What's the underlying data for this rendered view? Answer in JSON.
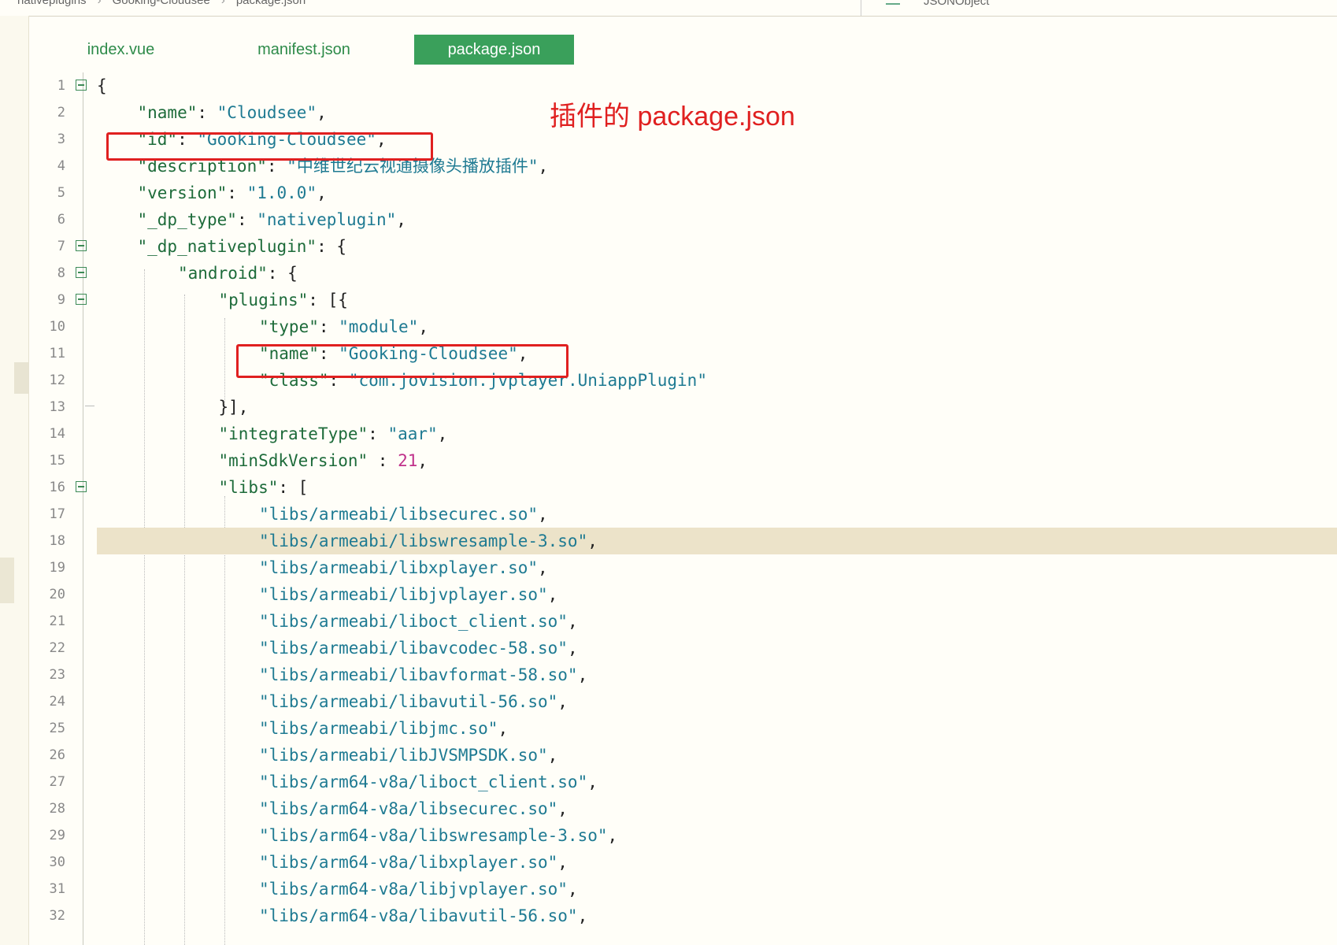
{
  "breadcrumb": [
    "nativeplugins",
    "Gooking-Cloudsee",
    "package.json"
  ],
  "outline_label": "JSONObject",
  "tabs": [
    {
      "label": "index.vue",
      "active": false
    },
    {
      "label": "manifest.json",
      "active": false
    },
    {
      "label": "package.json",
      "active": true
    }
  ],
  "annotation": "插件的 package.json",
  "colors": {
    "accent": "#3aa05b",
    "annotation": "#e02020",
    "highlight_line": "#ece3c9"
  },
  "highlighted_line": 18,
  "lines": [
    {
      "n": "1",
      "indent": 0,
      "fold": true,
      "parts": [
        [
          "p",
          "{"
        ]
      ]
    },
    {
      "n": "2",
      "indent": 1,
      "parts": [
        [
          "k",
          "\"name\""
        ],
        [
          "p",
          ": "
        ],
        [
          "s",
          "\"Cloudsee\""
        ],
        [
          "p",
          ","
        ]
      ]
    },
    {
      "n": "3",
      "indent": 1,
      "parts": [
        [
          "k",
          "\"id\""
        ],
        [
          "p",
          ": "
        ],
        [
          "s",
          "\"Gooking-Cloudsee\""
        ],
        [
          "p",
          ","
        ]
      ]
    },
    {
      "n": "4",
      "indent": 1,
      "parts": [
        [
          "k",
          "\"description\""
        ],
        [
          "p",
          ": "
        ],
        [
          "s",
          "\"中维世纪云视通摄像头播放插件\""
        ],
        [
          "p",
          ","
        ]
      ]
    },
    {
      "n": "5",
      "indent": 1,
      "parts": [
        [
          "k",
          "\"version\""
        ],
        [
          "p",
          ": "
        ],
        [
          "s",
          "\"1.0.0\""
        ],
        [
          "p",
          ","
        ]
      ]
    },
    {
      "n": "6",
      "indent": 1,
      "parts": [
        [
          "k",
          "\"_dp_type\""
        ],
        [
          "p",
          ": "
        ],
        [
          "s",
          "\"nativeplugin\""
        ],
        [
          "p",
          ","
        ]
      ]
    },
    {
      "n": "7",
      "indent": 1,
      "fold": true,
      "parts": [
        [
          "k",
          "\"_dp_nativeplugin\""
        ],
        [
          "p",
          ": {"
        ]
      ]
    },
    {
      "n": "8",
      "indent": 2,
      "fold": true,
      "parts": [
        [
          "k",
          "\"android\""
        ],
        [
          "p",
          ": {"
        ]
      ]
    },
    {
      "n": "9",
      "indent": 3,
      "fold": true,
      "parts": [
        [
          "k",
          "\"plugins\""
        ],
        [
          "p",
          ": [{"
        ]
      ]
    },
    {
      "n": "10",
      "indent": 4,
      "parts": [
        [
          "k",
          "\"type\""
        ],
        [
          "p",
          ": "
        ],
        [
          "s",
          "\"module\""
        ],
        [
          "p",
          ","
        ]
      ]
    },
    {
      "n": "11",
      "indent": 4,
      "parts": [
        [
          "k",
          "\"name\""
        ],
        [
          "p",
          ": "
        ],
        [
          "s",
          "\"Gooking-Cloudsee\""
        ],
        [
          "p",
          ","
        ]
      ]
    },
    {
      "n": "12",
      "indent": 4,
      "parts": [
        [
          "k",
          "\"class\""
        ],
        [
          "p",
          ": "
        ],
        [
          "s",
          "\"com.jovision.jvplayer.UniappPlugin\""
        ]
      ]
    },
    {
      "n": "13",
      "indent": 3,
      "foldend": true,
      "parts": [
        [
          "p",
          "}],"
        ]
      ]
    },
    {
      "n": "14",
      "indent": 3,
      "parts": [
        [
          "k",
          "\"integrateType\""
        ],
        [
          "p",
          ": "
        ],
        [
          "s",
          "\"aar\""
        ],
        [
          "p",
          ","
        ]
      ]
    },
    {
      "n": "15",
      "indent": 3,
      "parts": [
        [
          "k",
          "\"minSdkVersion\""
        ],
        [
          "p",
          " : "
        ],
        [
          "n",
          "21"
        ],
        [
          "p",
          ","
        ]
      ]
    },
    {
      "n": "16",
      "indent": 3,
      "fold": true,
      "parts": [
        [
          "k",
          "\"libs\""
        ],
        [
          "p",
          ": ["
        ]
      ]
    },
    {
      "n": "17",
      "indent": 4,
      "parts": [
        [
          "s",
          "\"libs/armeabi/libsecurec.so\""
        ],
        [
          "p",
          ","
        ]
      ]
    },
    {
      "n": "18",
      "indent": 4,
      "parts": [
        [
          "s",
          "\"libs/armeabi/libswresample-3.so\""
        ],
        [
          "p",
          ","
        ]
      ]
    },
    {
      "n": "19",
      "indent": 4,
      "parts": [
        [
          "s",
          "\"libs/armeabi/libxplayer.so\""
        ],
        [
          "p",
          ","
        ]
      ]
    },
    {
      "n": "20",
      "indent": 4,
      "parts": [
        [
          "s",
          "\"libs/armeabi/libjvplayer.so\""
        ],
        [
          "p",
          ","
        ]
      ]
    },
    {
      "n": "21",
      "indent": 4,
      "parts": [
        [
          "s",
          "\"libs/armeabi/liboct_client.so\""
        ],
        [
          "p",
          ","
        ]
      ]
    },
    {
      "n": "22",
      "indent": 4,
      "parts": [
        [
          "s",
          "\"libs/armeabi/libavcodec-58.so\""
        ],
        [
          "p",
          ","
        ]
      ]
    },
    {
      "n": "23",
      "indent": 4,
      "parts": [
        [
          "s",
          "\"libs/armeabi/libavformat-58.so\""
        ],
        [
          "p",
          ","
        ]
      ]
    },
    {
      "n": "24",
      "indent": 4,
      "parts": [
        [
          "s",
          "\"libs/armeabi/libavutil-56.so\""
        ],
        [
          "p",
          ","
        ]
      ]
    },
    {
      "n": "25",
      "indent": 4,
      "parts": [
        [
          "s",
          "\"libs/armeabi/libjmc.so\""
        ],
        [
          "p",
          ","
        ]
      ]
    },
    {
      "n": "26",
      "indent": 4,
      "parts": [
        [
          "s",
          "\"libs/armeabi/libJVSMPSDK.so\""
        ],
        [
          "p",
          ","
        ]
      ]
    },
    {
      "n": "27",
      "indent": 4,
      "parts": [
        [
          "s",
          "\"libs/arm64-v8a/liboct_client.so\""
        ],
        [
          "p",
          ","
        ]
      ]
    },
    {
      "n": "28",
      "indent": 4,
      "parts": [
        [
          "s",
          "\"libs/arm64-v8a/libsecurec.so\""
        ],
        [
          "p",
          ","
        ]
      ]
    },
    {
      "n": "29",
      "indent": 4,
      "parts": [
        [
          "s",
          "\"libs/arm64-v8a/libswresample-3.so\""
        ],
        [
          "p",
          ","
        ]
      ]
    },
    {
      "n": "30",
      "indent": 4,
      "parts": [
        [
          "s",
          "\"libs/arm64-v8a/libxplayer.so\""
        ],
        [
          "p",
          ","
        ]
      ]
    },
    {
      "n": "31",
      "indent": 4,
      "parts": [
        [
          "s",
          "\"libs/arm64-v8a/libjvplayer.so\""
        ],
        [
          "p",
          ","
        ]
      ]
    },
    {
      "n": "32",
      "indent": 4,
      "parts": [
        [
          "s",
          "\"libs/arm64-v8a/libavutil-56.so\""
        ],
        [
          "p",
          ","
        ]
      ]
    }
  ]
}
